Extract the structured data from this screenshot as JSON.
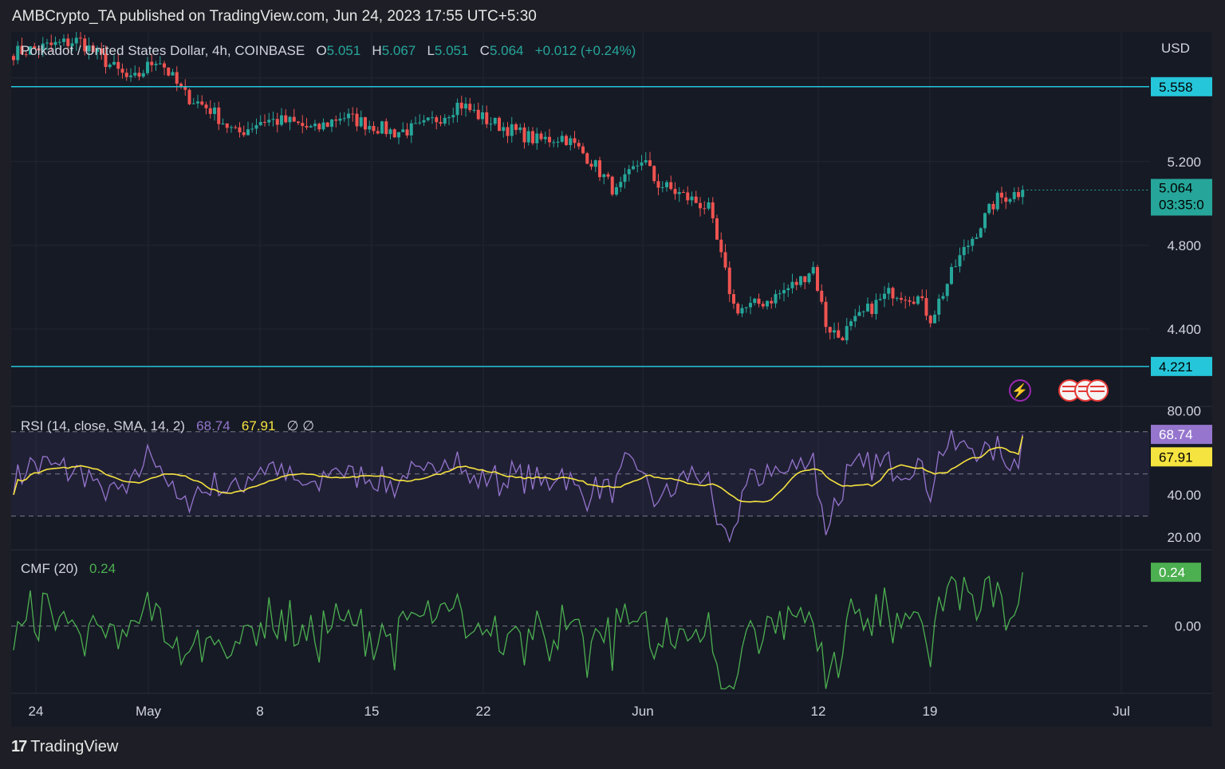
{
  "header": {
    "publisher": "AMBCrypto_TA published on TradingView.com, Jun 24, 2023 17:55 UTC+5:30"
  },
  "footer": {
    "brand": "TradingView"
  },
  "legend": {
    "symbol": "Polkadot / United States Dollar, 4h, COINBASE",
    "o_label": "O",
    "o_value": "5.051",
    "h_label": "H",
    "h_value": "5.067",
    "l_label": "L",
    "l_value": "5.051",
    "c_label": "C",
    "c_value": "5.064",
    "change": "+0.012 (+0.24%)"
  },
  "rsi_legend": {
    "label": "RSI (14, close, SMA, 14, 2)",
    "rsi": "68.74",
    "sma": "67.91",
    "extra": "∅ ∅"
  },
  "cmf_legend": {
    "label": "CMF (20)",
    "value": "0.24"
  },
  "currency": "USD",
  "colors": {
    "up": "#26a69a",
    "down": "#ef5350",
    "level": "#26c6da",
    "rsi": "#9575cd",
    "rsi_sma": "#f5e33f",
    "cmf": "#4caf50"
  },
  "chart_data": [
    {
      "type": "candlestick",
      "title": "Polkadot / United States Dollar, 4h, COINBASE",
      "x_ticks": [
        "24",
        "May",
        "8",
        "15",
        "22",
        "Jun",
        "12",
        "19",
        "Jul"
      ],
      "y_ticks": [
        5.2,
        4.8,
        4.4
      ],
      "ylim": [
        4.03,
        5.82
      ],
      "horizontal_levels": [
        5.558,
        4.221
      ],
      "last_price": 5.064,
      "countdown": "03:35:0",
      "price_path_anchors": [
        [
          0,
          5.72
        ],
        [
          5,
          5.78
        ],
        [
          7,
          5.68
        ],
        [
          9,
          5.58
        ],
        [
          11,
          5.7
        ],
        [
          13,
          5.52
        ],
        [
          15,
          5.45
        ],
        [
          17,
          5.33
        ],
        [
          19,
          5.4
        ],
        [
          21,
          5.39
        ],
        [
          23,
          5.35
        ],
        [
          25,
          5.42
        ],
        [
          27,
          5.38
        ],
        [
          29,
          5.34
        ],
        [
          31,
          5.36
        ],
        [
          33,
          5.43
        ],
        [
          34,
          5.48
        ],
        [
          36,
          5.4
        ],
        [
          38,
          5.35
        ],
        [
          40,
          5.3
        ],
        [
          42,
          5.32
        ],
        [
          44,
          5.21
        ],
        [
          46,
          5.05
        ],
        [
          48,
          5.22
        ],
        [
          49,
          5.1
        ],
        [
          51,
          5.04
        ],
        [
          53,
          4.98
        ],
        [
          55,
          4.5
        ],
        [
          56,
          4.5
        ],
        [
          58,
          4.55
        ],
        [
          60,
          4.63
        ],
        [
          61,
          4.7
        ],
        [
          62,
          4.42
        ],
        [
          63,
          4.36
        ],
        [
          65,
          4.48
        ],
        [
          67,
          4.58
        ],
        [
          69,
          4.55
        ],
        [
          70,
          4.45
        ],
        [
          72,
          4.72
        ],
        [
          73,
          4.82
        ],
        [
          75,
          5.02
        ],
        [
          77,
          5.06
        ]
      ],
      "series": [
        {
          "name": "Polkadot / United States Dollar"
        }
      ]
    },
    {
      "type": "line",
      "title": "RSI (14, close, SMA, 14, 2)",
      "y_ticks": [
        80,
        40,
        20
      ],
      "ylim": [
        14,
        82
      ],
      "bands": [
        70,
        50,
        30
      ],
      "series": [
        {
          "name": "RSI",
          "last": 68.74
        },
        {
          "name": "RSI-based MA",
          "last": 67.91
        }
      ]
    },
    {
      "type": "line",
      "title": "CMF (20)",
      "y_ticks": [
        0
      ],
      "ylim": [
        -0.3,
        0.34
      ],
      "series": [
        {
          "name": "CMF",
          "last": 0.24
        }
      ]
    }
  ]
}
